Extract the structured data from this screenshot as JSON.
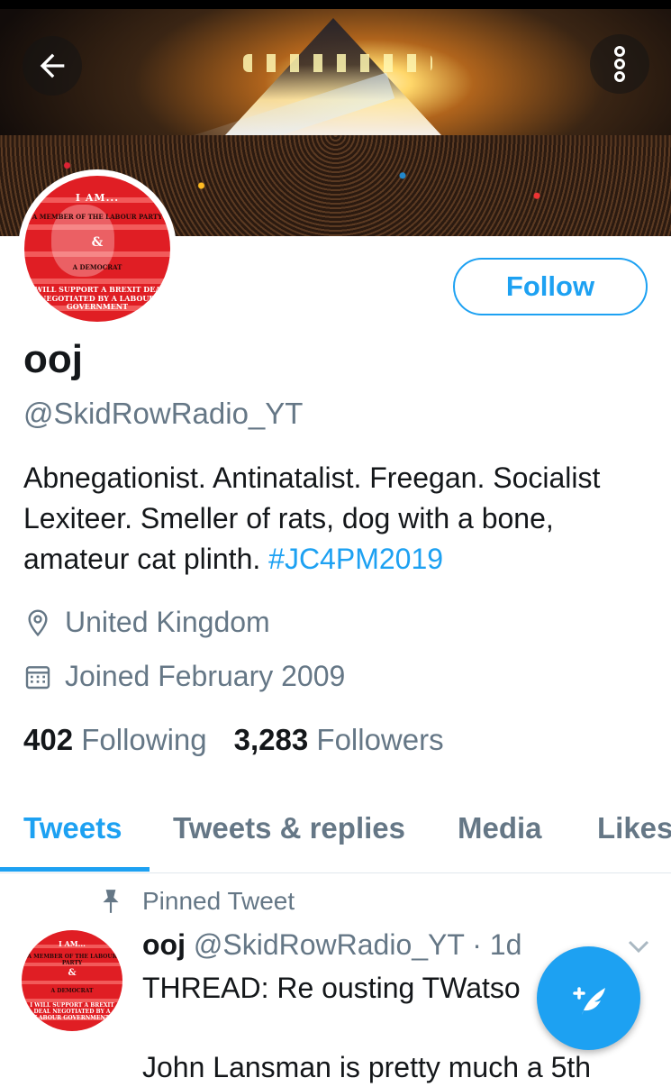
{
  "profile": {
    "name": "ooj",
    "handle": "@SkidRowRadio_YT",
    "bio_text": "Abnegationist. Antinatalist. Freegan. Socialist Lexiteer.  Smeller of rats, dog with a bone, amateur cat plinth. ",
    "bio_hashtag": "#JC4PM2019",
    "location": "United Kingdom",
    "joined": "Joined February 2009",
    "following_count": "402",
    "following_label": "Following",
    "followers_count": "3,283",
    "followers_label": "Followers",
    "follow_button": "Follow",
    "avatar_text": [
      "I AM...",
      "A MEMBER OF THE LABOUR PARTY",
      "&",
      "A DEMOCRAT",
      "I WILL SUPPORT A BREXIT DEAL NEGOTIATED BY A LABOUR GOVERNMENT"
    ]
  },
  "tabs": [
    {
      "label": "Tweets",
      "active": true
    },
    {
      "label": "Tweets & replies",
      "active": false
    },
    {
      "label": "Media",
      "active": false
    },
    {
      "label": "Likes",
      "active": false
    }
  ],
  "pinned_tweet": {
    "pinned_label": "Pinned Tweet",
    "author_name": "ooj",
    "author_handle": "@SkidRowRadio_YT",
    "time": "· 1d",
    "text": "THREAD: Re ousting TWatso\n\nJohn Lansman is pretty much a 5th"
  },
  "colors": {
    "accent": "#1da1f2",
    "secondary_text": "#657786",
    "primary_text": "#14171a"
  },
  "icons": [
    "back-arrow-icon",
    "more-vertical-icon",
    "location-pin-icon",
    "calendar-icon",
    "pin-icon",
    "chevron-down-icon",
    "compose-tweet-icon"
  ]
}
